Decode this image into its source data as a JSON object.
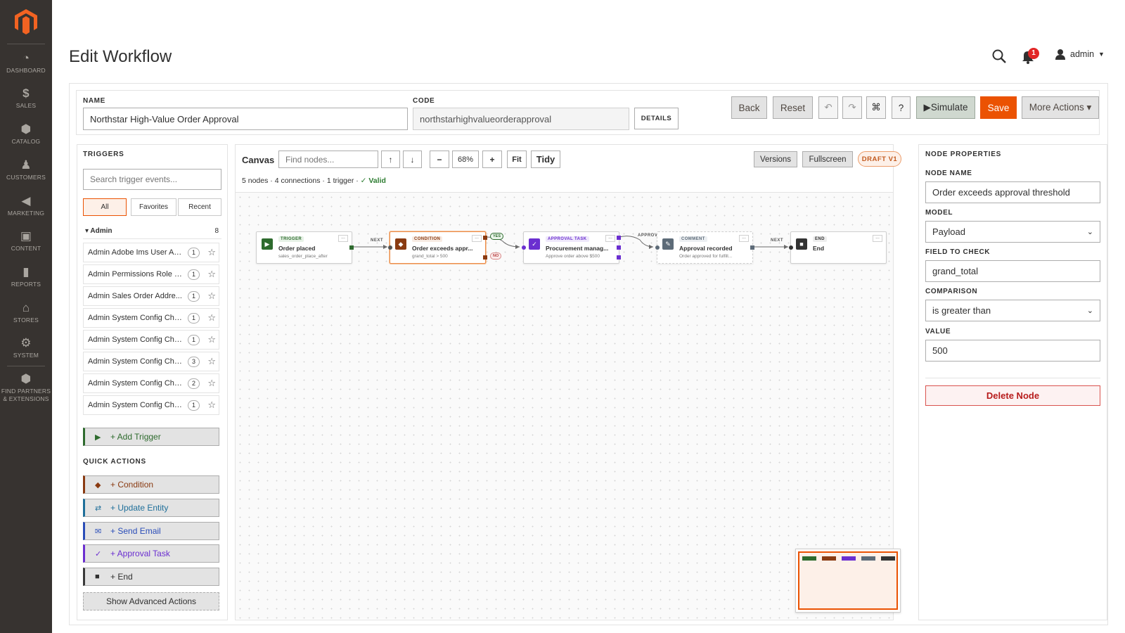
{
  "nav": {
    "items": [
      {
        "label": "DASHBOARD",
        "icon": "dashboard-icon"
      },
      {
        "label": "SALES",
        "icon": "dollar-icon"
      },
      {
        "label": "CATALOG",
        "icon": "box-icon"
      },
      {
        "label": "CUSTOMERS",
        "icon": "person-icon"
      },
      {
        "label": "MARKETING",
        "icon": "megaphone-icon"
      },
      {
        "label": "CONTENT",
        "icon": "content-icon"
      },
      {
        "label": "REPORTS",
        "icon": "bar-chart-icon"
      },
      {
        "label": "STORES",
        "icon": "store-icon"
      },
      {
        "label": "SYSTEM",
        "icon": "gear-icon"
      },
      {
        "label": "FIND PARTNERS",
        "label2": "& EXTENSIONS",
        "icon": "extensions-icon"
      }
    ]
  },
  "header": {
    "title": "Edit Workflow",
    "notifications": "1",
    "user": "admin"
  },
  "form": {
    "name_label": "NAME",
    "name_value": "Northstar High-Value Order Approval",
    "code_label": "CODE",
    "code_value": "northstarhighvalueorderapproval",
    "details": "DETAILS"
  },
  "actions": {
    "back": "Back",
    "reset": "Reset",
    "undo": "↶",
    "redo": "↷",
    "shortcuts": "⌘",
    "help": "?",
    "simulate": "▶Simulate",
    "save": "Save",
    "more": "More Actions ▾"
  },
  "triggers": {
    "title": "TRIGGERS",
    "search_placeholder": "Search trigger events...",
    "tabs": [
      "All",
      "Favorites",
      "Recent"
    ],
    "group": {
      "name": "▾ Admin",
      "count": "8"
    },
    "items": [
      {
        "name": "Admin Adobe Ims User Au...",
        "count": "1"
      },
      {
        "name": "Admin Permissions Role P...",
        "count": "1"
      },
      {
        "name": "Admin Sales Order Addre...",
        "count": "1"
      },
      {
        "name": "Admin System Config Cha...",
        "count": "1"
      },
      {
        "name": "Admin System Config Cha...",
        "count": "1"
      },
      {
        "name": "Admin System Config Cha...",
        "count": "3"
      },
      {
        "name": "Admin System Config Cha...",
        "count": "2"
      },
      {
        "name": "Admin System Config Cha...",
        "count": "1"
      }
    ],
    "add_trigger": "+ Add Trigger",
    "quick_title": "QUICK ACTIONS",
    "quick": [
      {
        "label": "+ Condition",
        "glyph": "◆",
        "color": "#8a3b12"
      },
      {
        "label": "+ Update Entity",
        "glyph": "⇄",
        "color": "#1f6f9a"
      },
      {
        "label": "+ Send Email",
        "glyph": "✉",
        "color": "#2a4db8"
      },
      {
        "label": "+ Approval Task",
        "glyph": "✓",
        "color": "#6b2fd0"
      },
      {
        "label": "+ End",
        "glyph": "■",
        "color": "#3a3a3a"
      }
    ],
    "advanced": "Show Advanced Actions"
  },
  "canvas": {
    "title": "Canvas",
    "find_placeholder": "Find nodes...",
    "up": "↑",
    "down": "↓",
    "zoom_out": "−",
    "zoom": "68%",
    "zoom_in": "+",
    "fit": "Fit",
    "tidy": "Tidy",
    "versions": "Versions",
    "fullscreen": "Fullscreen",
    "draft": "DRAFT V1",
    "stats": "5 nodes · 4 connections · 1 trigger · ",
    "valid": "✓ Valid",
    "nodes": [
      {
        "type": "TRIGGER",
        "title": "Order placed",
        "sub": "sales_order_place_after",
        "glyph": "▶",
        "color": "#2e6b2e"
      },
      {
        "type": "CONDITION",
        "title": "Order exceeds appr...",
        "sub": "grand_total > 500",
        "glyph": "◆",
        "color": "#8a3b12"
      },
      {
        "type": "APPROVAL TASK",
        "title": "Procurement manag...",
        "sub": "Approve order above $500",
        "glyph": "✓",
        "color": "#6b2fd0"
      },
      {
        "type": "COMMENT",
        "title": "Approval recorded",
        "sub": "Order approved for fulfill...",
        "glyph": "✎",
        "color": "#5d6b78"
      },
      {
        "type": "END",
        "title": "End",
        "sub": "",
        "glyph": "■",
        "color": "#333333"
      }
    ],
    "edges": {
      "next1": "NEXT",
      "yes": "YES",
      "no": "NO",
      "approved": "APPROV",
      "next2": "NEXT"
    },
    "node_menu": "..."
  },
  "props": {
    "title": "NODE PROPERTIES",
    "name_label": "NODE NAME",
    "name_value": "Order exceeds approval threshold",
    "model_label": "MODEL",
    "model_value": "Payload",
    "field_label": "FIELD TO CHECK",
    "field_value": "grand_total",
    "comparison_label": "COMPARISON",
    "comparison_value": "is greater than",
    "value_label": "VALUE",
    "value_value": "500",
    "delete": "Delete Node"
  }
}
